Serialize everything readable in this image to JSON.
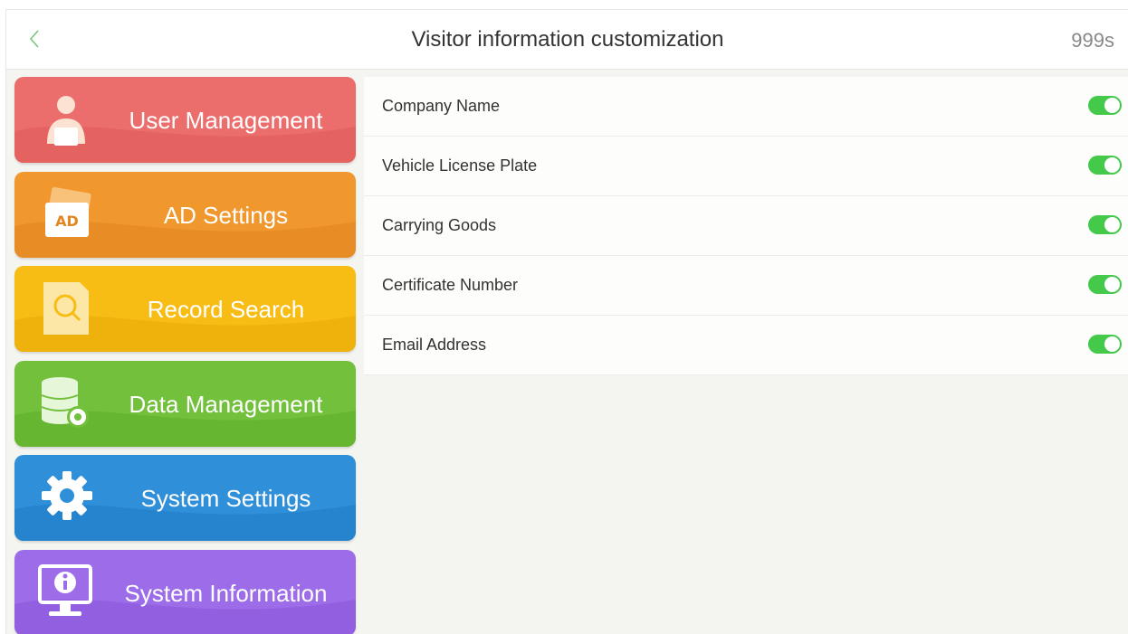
{
  "header": {
    "title": "Visitor information customization",
    "timer": "999s"
  },
  "sidebar": {
    "items": [
      {
        "label": "User Management",
        "icon": "user-icon",
        "color": "#ec6e6c"
      },
      {
        "label": "AD Settings",
        "icon": "ad-icon",
        "icon_text": "AD",
        "color": "#f0982e"
      },
      {
        "label": "Record Search",
        "icon": "search-document-icon",
        "color": "#f7bd14"
      },
      {
        "label": "Data Management",
        "icon": "database-gear-icon",
        "color": "#72c03c"
      },
      {
        "label": "System Settings",
        "icon": "gear-icon",
        "color": "#2f8fd8"
      },
      {
        "label": "System Information",
        "icon": "monitor-info-icon",
        "color": "#9d6ce8"
      }
    ]
  },
  "fields": [
    {
      "label": "Company Name",
      "enabled": true
    },
    {
      "label": "Vehicle License Plate",
      "enabled": true
    },
    {
      "label": "Carrying Goods",
      "enabled": true
    },
    {
      "label": "Certificate Number",
      "enabled": true
    },
    {
      "label": "Email Address",
      "enabled": true
    }
  ],
  "colors": {
    "toggle_on": "#44c94a",
    "back_arrow": "#7bc47f"
  }
}
